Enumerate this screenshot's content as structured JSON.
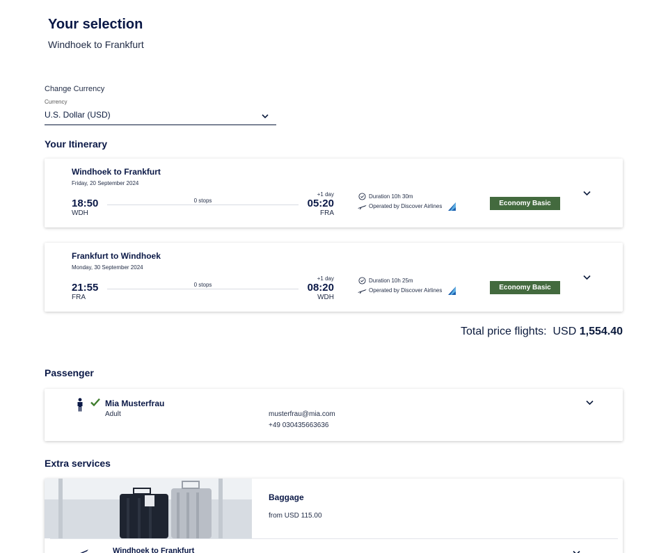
{
  "header": {
    "title": "Your selection",
    "subtitle": "Windhoek to Frankfurt"
  },
  "currency": {
    "change_label": "Change Currency",
    "field_label": "Currency",
    "value": "U.S. Dollar (USD)",
    "icon": "chevron-down-icon"
  },
  "itinerary": {
    "title": "Your Itinerary",
    "flights": [
      {
        "route": "Windhoek to Frankfurt",
        "date": "Friday, 20 September 2024",
        "dep_time": "18:50",
        "dep_code": "WDH",
        "stops": "0 stops",
        "plus_day": "+1 day",
        "arr_time": "05:20",
        "arr_code": "FRA",
        "duration": "Duration 10h 30m",
        "operated": "Operated by Discover Airlines",
        "fare": "Economy Basic"
      },
      {
        "route": "Frankfurt to Windhoek",
        "date": "Monday, 30 September 2024",
        "dep_time": "21:55",
        "dep_code": "FRA",
        "stops": "0 stops",
        "plus_day": "+1 day",
        "arr_time": "08:20",
        "arr_code": "WDH",
        "duration": "Duration 10h 25m",
        "operated": "Operated by Discover Airlines",
        "fare": "Economy Basic"
      }
    ]
  },
  "total": {
    "label": "Total price flights:",
    "currency": "USD",
    "amount": "1,554.40"
  },
  "passenger": {
    "title": "Passenger",
    "name": "Mia Musterfrau",
    "type": "Adult",
    "email": "musterfrau@mia.com",
    "phone": "+49 030435663636"
  },
  "extras": {
    "title": "Extra services",
    "baggage_title": "Baggage",
    "baggage_price": "from USD  115.00",
    "route": "Windhoek to Frankfurt"
  },
  "colors": {
    "navy": "#0a1846",
    "fare_green": "#436a3e",
    "check_green": "#3f7d2e"
  }
}
